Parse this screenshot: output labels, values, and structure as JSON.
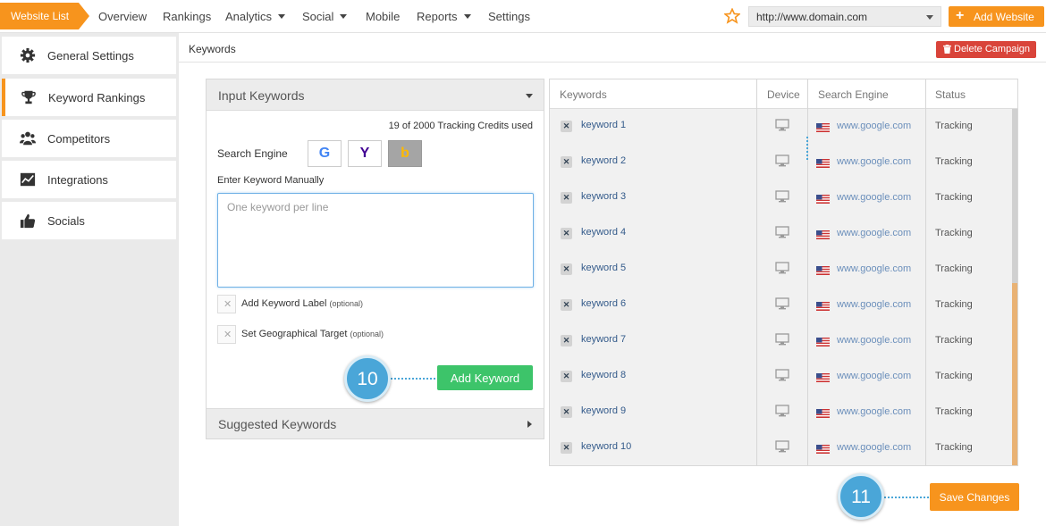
{
  "topnav": {
    "brand_label": "Website List",
    "items": [
      {
        "label": "Overview",
        "dropdown": false
      },
      {
        "label": "Rankings",
        "dropdown": false
      },
      {
        "label": "Analytics",
        "dropdown": true
      },
      {
        "label": "Social",
        "dropdown": true
      },
      {
        "label": "Mobile",
        "dropdown": false
      },
      {
        "label": "Reports",
        "dropdown": true
      },
      {
        "label": "Settings",
        "dropdown": false
      }
    ],
    "domain_value": "http://www.domain.com",
    "add_website_label": "Add Website"
  },
  "sidebar": {
    "items": [
      {
        "label": "General Settings",
        "icon": "gear-icon"
      },
      {
        "label": "Keyword Rankings",
        "icon": "trophy-icon",
        "active": true
      },
      {
        "label": "Competitors",
        "icon": "users-icon"
      },
      {
        "label": "Integrations",
        "icon": "chart-icon"
      },
      {
        "label": "Socials",
        "icon": "thumbs-up-icon"
      }
    ]
  },
  "breadcrumb": "Keywords",
  "delete_campaign_label": "Delete Campaign",
  "input_panel": {
    "title": "Input Keywords",
    "credits": "19 of 2000 Tracking Credits used",
    "search_engine_label": "Search Engine",
    "engines": [
      "G",
      "Y",
      "b"
    ],
    "selected_engine": "b",
    "enter_manual_label": "Enter Keyword Manually",
    "textarea_placeholder": "One keyword per line",
    "add_label_text": "Add Keyword Label",
    "geo_target_text": "Set Geographical Target",
    "optional_text": "(optional)",
    "add_keyword_button": "Add Keyword",
    "suggested_title": "Suggested Keywords"
  },
  "steps": {
    "add_keyword_step": "10",
    "save_step": "11"
  },
  "table": {
    "headers": [
      "Keywords",
      "Device",
      "Search Engine",
      "Status"
    ],
    "rows": [
      {
        "keyword": "keyword 1",
        "engine": "www.google.com",
        "status": "Tracking"
      },
      {
        "keyword": "keyword 2",
        "engine": "www.google.com",
        "status": "Tracking"
      },
      {
        "keyword": "keyword 3",
        "engine": "www.google.com",
        "status": "Tracking"
      },
      {
        "keyword": "keyword 4",
        "engine": "www.google.com",
        "status": "Tracking"
      },
      {
        "keyword": "keyword 5",
        "engine": "www.google.com",
        "status": "Tracking"
      },
      {
        "keyword": "keyword 6",
        "engine": "www.google.com",
        "status": "Tracking"
      },
      {
        "keyword": "keyword 7",
        "engine": "www.google.com",
        "status": "Tracking"
      },
      {
        "keyword": "keyword 8",
        "engine": "www.google.com",
        "status": "Tracking"
      },
      {
        "keyword": "keyword 9",
        "engine": "www.google.com",
        "status": "Tracking"
      },
      {
        "keyword": "keyword 10",
        "engine": "www.google.com",
        "status": "Tracking"
      }
    ]
  },
  "save_changes_label": "Save Changes",
  "colors": {
    "accent": "#f7941d",
    "success": "#3dc46a",
    "danger": "#d9443a",
    "step_bubble": "#4aa6d8"
  }
}
